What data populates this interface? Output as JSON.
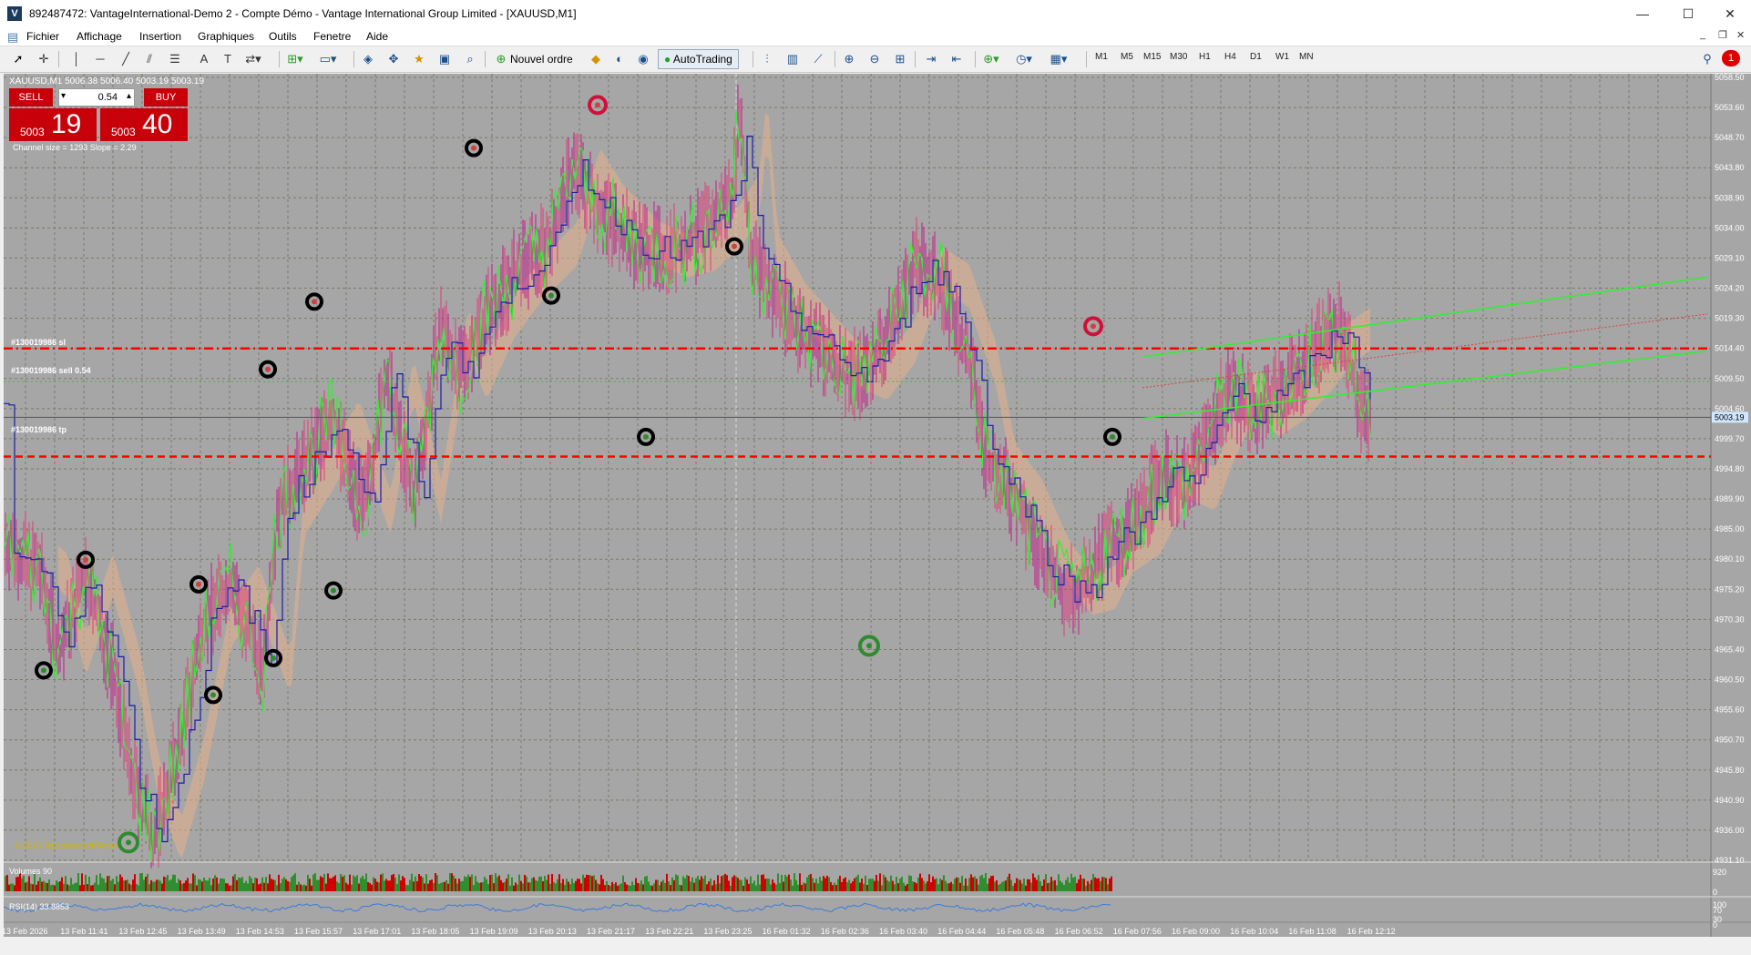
{
  "window": {
    "title": "892487472: VantageInternational-Demo 2 - Compte Démo - Vantage International Group Limited - [XAUUSD,M1]",
    "app_icon": "V",
    "controls": {
      "minimize": "—",
      "maximize": "☐",
      "close": "✕"
    }
  },
  "menu": {
    "items": [
      "Fichier",
      "Affichage",
      "Insertion",
      "Graphiques",
      "Outils",
      "Fenetre",
      "Aide"
    ],
    "mdi_controls": {
      "minimize": "_",
      "restore": "❐",
      "close": "✕"
    }
  },
  "toolbar": {
    "new_order_label": "Nouvel ordre",
    "autotrading_label": "AutoTrading",
    "timeframes": [
      "M1",
      "M5",
      "M15",
      "M30",
      "H1",
      "H4",
      "D1",
      "W1",
      "MN"
    ],
    "notification_count": "1"
  },
  "chart": {
    "symbol_info": "XAUUSD,M1  5006.38 5006.40 5003.19 5003.19",
    "one_click": {
      "sell_label": "SELL",
      "buy_label": "BUY",
      "lot_value": "0.54",
      "sell_price_small": "5003",
      "sell_price_big": "19",
      "buy_price_small": "5003",
      "buy_price_big": "40"
    },
    "channel_info": "Channel size = 1293 Slope = 2.29",
    "copyright": "© 2023 TopLessons.fr/Forex",
    "order_lines": [
      {
        "label": "#130019986 sl",
        "price": 5014.4
      },
      {
        "label": "#130019986 sell 0.54",
        "price": 5009.0
      },
      {
        "label": "#130019986 tp",
        "price": 4996.8
      }
    ],
    "current_price": "5003.19",
    "price_axis": [
      "5058.50",
      "5053.60",
      "5048.70",
      "5043.80",
      "5038.90",
      "5034.00",
      "5029.10",
      "5024.20",
      "5019.30",
      "5014.40",
      "5009.50",
      "5004.60",
      "4999.70",
      "4994.80",
      "4989.90",
      "4985.00",
      "4980.10",
      "4975.20",
      "4970.30",
      "4965.40",
      "4960.50",
      "4955.60",
      "4950.70",
      "4945.80",
      "4940.90",
      "4936.00",
      "4931.10"
    ],
    "time_axis": [
      "13 Feb 2026",
      "13 Feb 11:41",
      "13 Feb 12:45",
      "13 Feb 13:49",
      "13 Feb 14:53",
      "13 Feb 15:57",
      "13 Feb 17:01",
      "13 Feb 18:05",
      "13 Feb 19:09",
      "13 Feb 20:13",
      "13 Feb 21:17",
      "13 Feb 22:21",
      "13 Feb 23:25",
      "16 Feb 01:32",
      "16 Feb 02:36",
      "16 Feb 03:40",
      "16 Feb 04:44",
      "16 Feb 05:48",
      "16 Feb 06:52",
      "16 Feb 07:56",
      "16 Feb 09:00",
      "16 Feb 10:04",
      "16 Feb 11:08",
      "16 Feb 12:12"
    ],
    "volume_label": "Volumes 90",
    "volume_scale": [
      "920",
      "0"
    ],
    "rsi_label": "RSI(14) 33.8853",
    "rsi_scale": [
      "100",
      "70",
      "30",
      "0"
    ],
    "colors": {
      "background": "#a6a6a6",
      "grid": "#7a7a6a",
      "candle_line": "#1a1aa8",
      "fast_line": "#33ee33",
      "slow_bars": "#ff4466",
      "level_line": "#ff0000",
      "channel": "#33ee33",
      "swing_high_marker": "#000000",
      "swing_low_marker": "#2e8b2e",
      "volume_up": "#2f8f2f",
      "volume_down": "#d00000",
      "rsi_line": "#3b7bdc"
    }
  }
}
